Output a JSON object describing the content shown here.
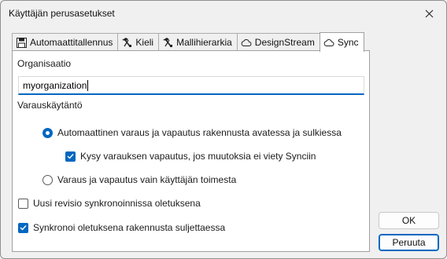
{
  "window": {
    "title": "Käyttäjän perusasetukset"
  },
  "tabs": [
    {
      "label": "Automaattitallennus",
      "icon": "save-icon",
      "active": false
    },
    {
      "label": "Kieli",
      "icon": "tools-icon",
      "active": false
    },
    {
      "label": "Mallihierarkia",
      "icon": "tools-icon",
      "active": false
    },
    {
      "label": "DesignStream",
      "icon": "cloud-icon",
      "active": false
    },
    {
      "label": "Sync",
      "icon": "cloud-icon",
      "active": true
    }
  ],
  "organization": {
    "label": "Organisaatio",
    "value": "myorganization"
  },
  "reservation": {
    "label": "Varauskäytäntö",
    "options": [
      {
        "label": "Automaattinen varaus ja vapautus rakennusta avatessa ja sulkiessa",
        "selected": true
      },
      {
        "label": "Varaus ja vapautus vain käyttäjän toimesta",
        "selected": false
      }
    ],
    "sub_checkbox": {
      "label": "Kysy varauksen vapautus, jos muutoksia ei viety Synciin",
      "checked": true
    }
  },
  "checkboxes": [
    {
      "label": "Uusi revisio synkronoinnissa oletuksena",
      "checked": false
    },
    {
      "label": "Synkronoi oletuksena rakennusta suljettaessa",
      "checked": true
    }
  ],
  "buttons": {
    "ok": "OK",
    "cancel": "Peruuta"
  },
  "colors": {
    "accent": "#0067c0",
    "background": "#f0f0f0"
  }
}
